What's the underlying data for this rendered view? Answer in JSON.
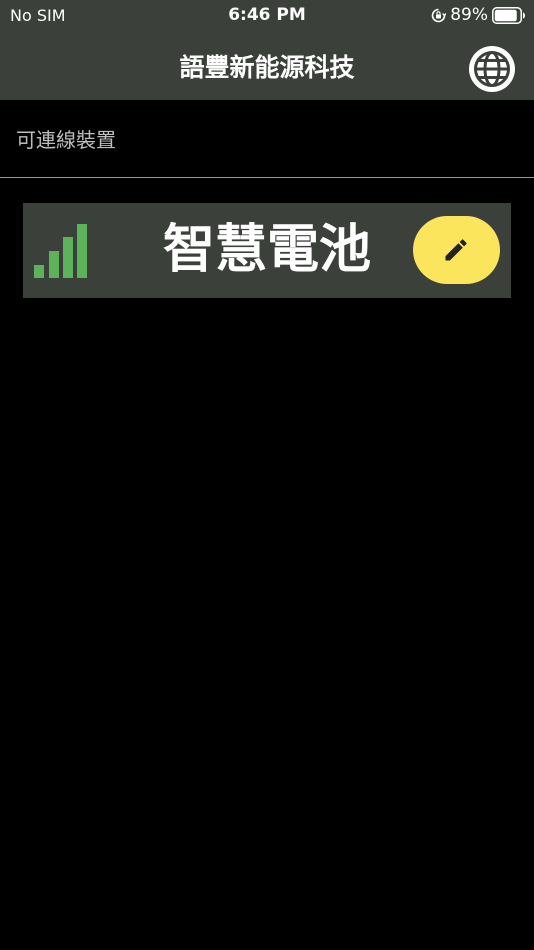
{
  "status_bar": {
    "carrier": "No SIM",
    "time": "6:46 PM",
    "battery_percent": "89%",
    "battery_level": 0.89,
    "icons": [
      "rotation-lock-icon",
      "battery-icon"
    ]
  },
  "header": {
    "title": "語豐新能源科技",
    "language_icon": "globe-icon"
  },
  "section": {
    "title": "可連線裝置"
  },
  "devices": [
    {
      "name": "智慧電池",
      "signal_icon": "signal-strength-icon",
      "signal_bars": 4,
      "edit_icon": "pencil-icon"
    }
  ],
  "colors": {
    "bar_background": "#3c403b",
    "page_background": "#000000",
    "signal_green": "#5cb35c",
    "edit_button_yellow": "#fbe55c"
  }
}
